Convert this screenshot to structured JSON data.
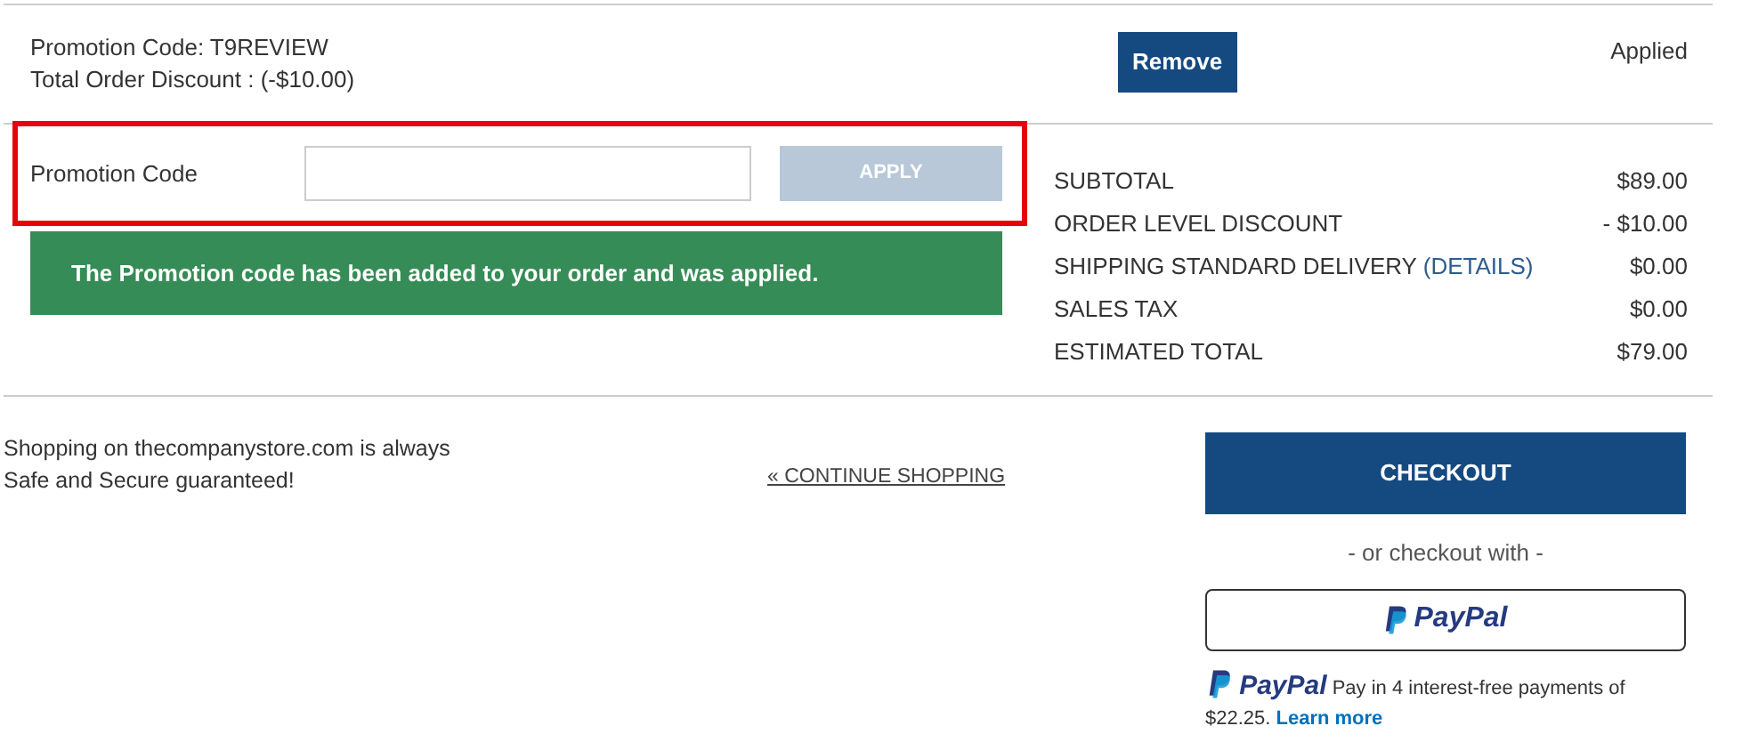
{
  "promotion": {
    "code_line": "Promotion Code: T9REVIEW",
    "discount_line": "Total Order Discount : (-$10.00)",
    "remove_button": "Remove",
    "status": "Applied"
  },
  "promo_form": {
    "label": "Promotion Code",
    "apply_button": "APPLY",
    "apply_disabled": true,
    "message": "The Promotion code has been added to your order and was applied."
  },
  "summary": [
    {
      "label": "SUBTOTAL",
      "value": "$89.00"
    },
    {
      "label": "ORDER LEVEL DISCOUNT",
      "value": "- $10.00"
    },
    {
      "label": "SHIPPING STANDARD DELIVERY",
      "link": "(DETAILS)",
      "value": "$0.00"
    },
    {
      "label": "SALES TAX",
      "value": "$0.00"
    },
    {
      "label": "ESTIMATED TOTAL",
      "value": "$79.00"
    }
  ],
  "footer": {
    "security_text": "Shopping on thecompanystore.com is always Safe and Secure guaranteed!",
    "continue_link": "« CONTINUE SHOPPING",
    "checkout_button": "CHECKOUT",
    "alt_checkout": "- or checkout with -",
    "paypal_button": "PayPal",
    "paypal_logo": "PayPal",
    "paypal_message": "Pay in 4 interest-free payments of $22.25.",
    "learn_more": "Learn more"
  }
}
